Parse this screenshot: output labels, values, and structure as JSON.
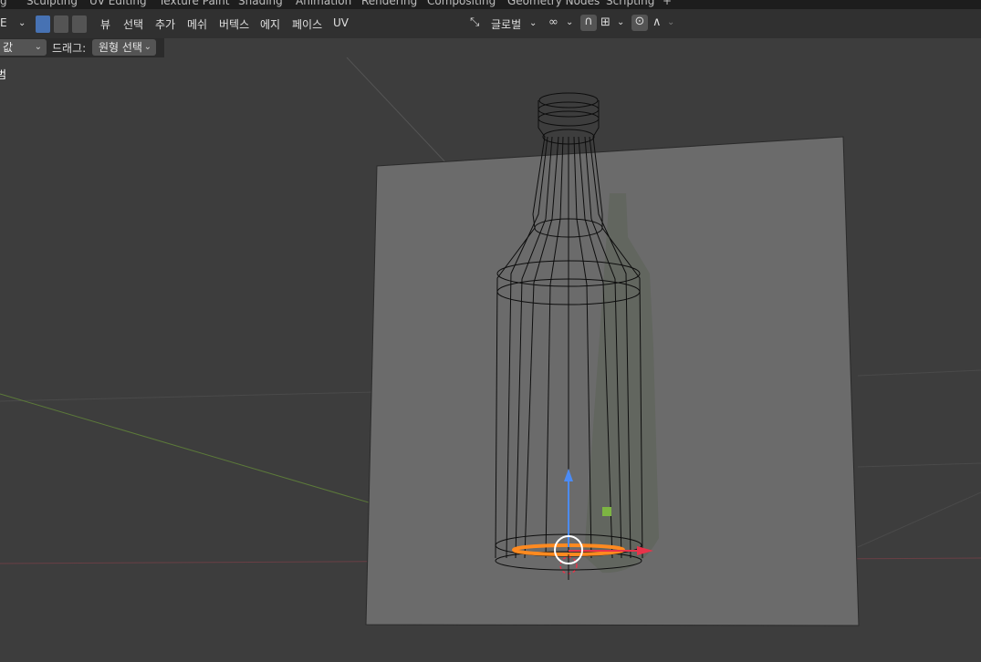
{
  "workspace_tabs": [
    "g",
    "Sculpting",
    "UV Editing",
    "Texture Paint",
    "Shading",
    "Animation",
    "Rendering",
    "Compositing",
    "Geometry Nodes",
    "Scripting",
    "+"
  ],
  "header": {
    "mode_glyph": "E",
    "menu": [
      "뷰",
      "선택",
      "추가",
      "메쉬",
      "버텍스",
      "에지",
      "페이스",
      "UV"
    ],
    "orientation": "글로벌"
  },
  "toolbar2": {
    "left_value": "값",
    "drag_label": "드래그:",
    "drag_value": "원형 선택"
  },
  "viewport": {
    "overlay_text": "범"
  },
  "colors": {
    "background": "#3d3d3d",
    "header": "#303030",
    "accent": "#4772b3",
    "selection": "#ff8a20",
    "axis_z": "#4b8bf5",
    "axis_x": "#e8344a"
  },
  "icons": [
    "vertex-select-icon",
    "edge-select-icon",
    "face-select-icon",
    "transform-orientation-icon",
    "pivot-link-icon",
    "snap-magnet-icon",
    "snap-increment-icon",
    "proportional-edit-icon",
    "falloff-curve-icon"
  ]
}
